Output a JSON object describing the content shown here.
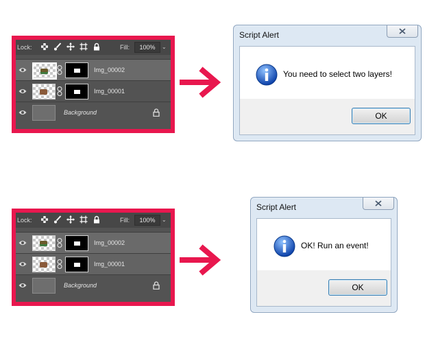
{
  "panels": [
    {
      "lock_label": "Lock:",
      "fill_label": "Fill:",
      "fill_value": "100%",
      "lock_icons": [
        "lock-transparent-pixels-icon",
        "lock-image-pixels-icon",
        "lock-position-icon",
        "lock-artboard-icon",
        "lock-all-icon"
      ],
      "layers": [
        {
          "name": "Img_00002",
          "selected": true
        },
        {
          "name": "Img_00001",
          "selected": false
        },
        {
          "name": "Background",
          "selected": false
        }
      ]
    },
    {
      "lock_label": "Lock:",
      "fill_label": "Fill:",
      "fill_value": "100%",
      "lock_icons": [
        "lock-transparent-pixels-icon",
        "lock-image-pixels-icon",
        "lock-position-icon",
        "lock-artboard-icon",
        "lock-all-icon"
      ],
      "layers": [
        {
          "name": "Img_00002",
          "selected": true
        },
        {
          "name": "Img_00001",
          "selected": true
        },
        {
          "name": "Background",
          "selected": false
        }
      ]
    }
  ],
  "dialogs": [
    {
      "title": "Script Alert",
      "message": "You need to select two layers!",
      "ok_label": "OK",
      "icon": "info-icon"
    },
    {
      "title": "Script Alert",
      "message": "OK! Run an event!",
      "ok_label": "OK",
      "icon": "info-icon"
    }
  ],
  "colors": {
    "highlight_frame": "#e8174e",
    "arrow": "#e8174e",
    "panel_bg": "#535353"
  }
}
